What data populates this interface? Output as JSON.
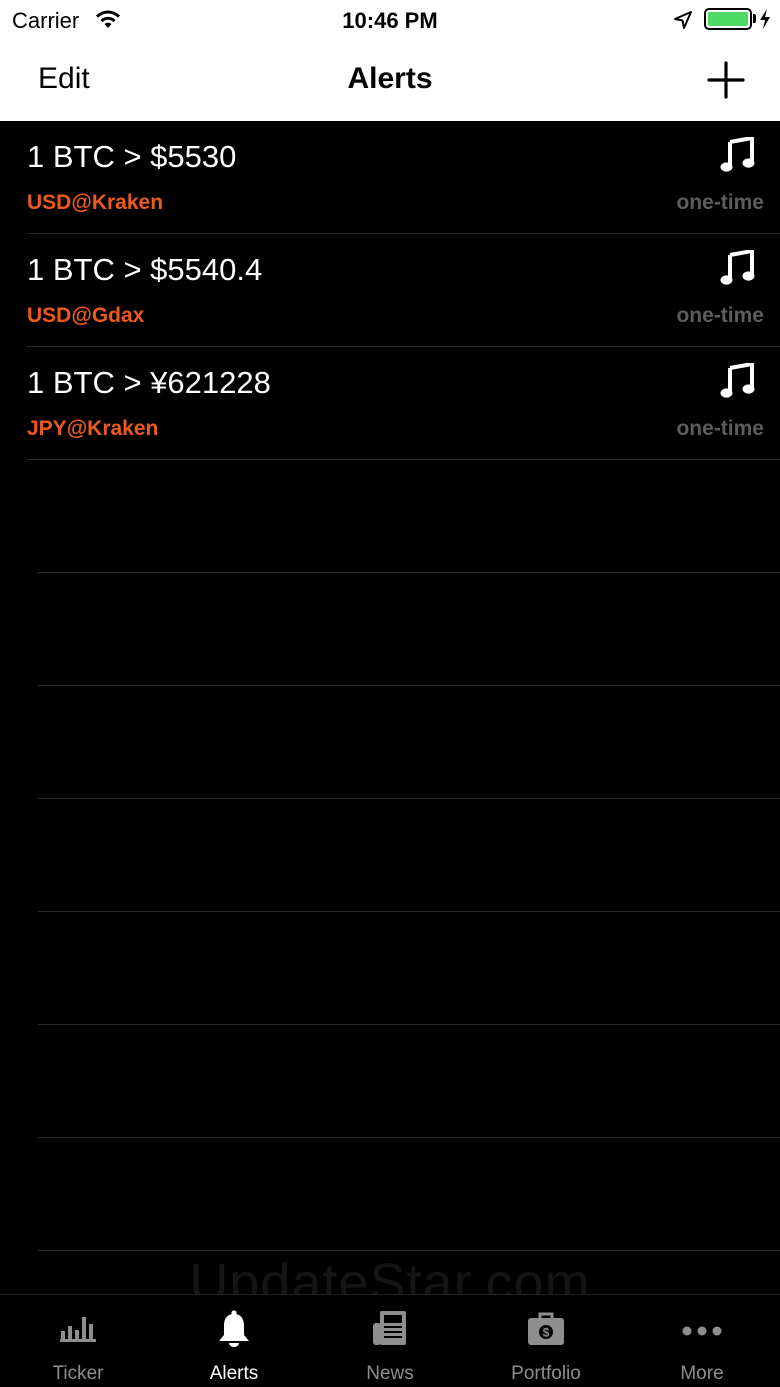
{
  "status_bar": {
    "carrier": "Carrier",
    "time": "10:46 PM"
  },
  "nav": {
    "edit_label": "Edit",
    "title": "Alerts",
    "add_icon": "plus-icon"
  },
  "alerts": [
    {
      "title": "1 BTC > $5530",
      "market": "USD@Kraken",
      "frequency": "one-time",
      "icon": "music-note-icon"
    },
    {
      "title": "1 BTC > $5540.4",
      "market": "USD@Gdax",
      "frequency": "one-time",
      "icon": "music-note-icon"
    },
    {
      "title": "1 BTC > ¥621228",
      "market": "JPY@Kraken",
      "frequency": "one-time",
      "icon": "music-note-icon"
    }
  ],
  "watermark": "UpdateStar.com",
  "tabs": [
    {
      "label": "Ticker",
      "icon": "bar-chart-icon",
      "active": false
    },
    {
      "label": "Alerts",
      "icon": "bell-icon",
      "active": true
    },
    {
      "label": "News",
      "icon": "newspaper-icon",
      "active": false
    },
    {
      "label": "Portfolio",
      "icon": "briefcase-icon",
      "active": false
    },
    {
      "label": "More",
      "icon": "more-dots-icon",
      "active": false
    }
  ],
  "colors": {
    "market_text": "#ec5a1c",
    "frequency_text": "#5d5d5d",
    "battery": "#4cd964"
  }
}
